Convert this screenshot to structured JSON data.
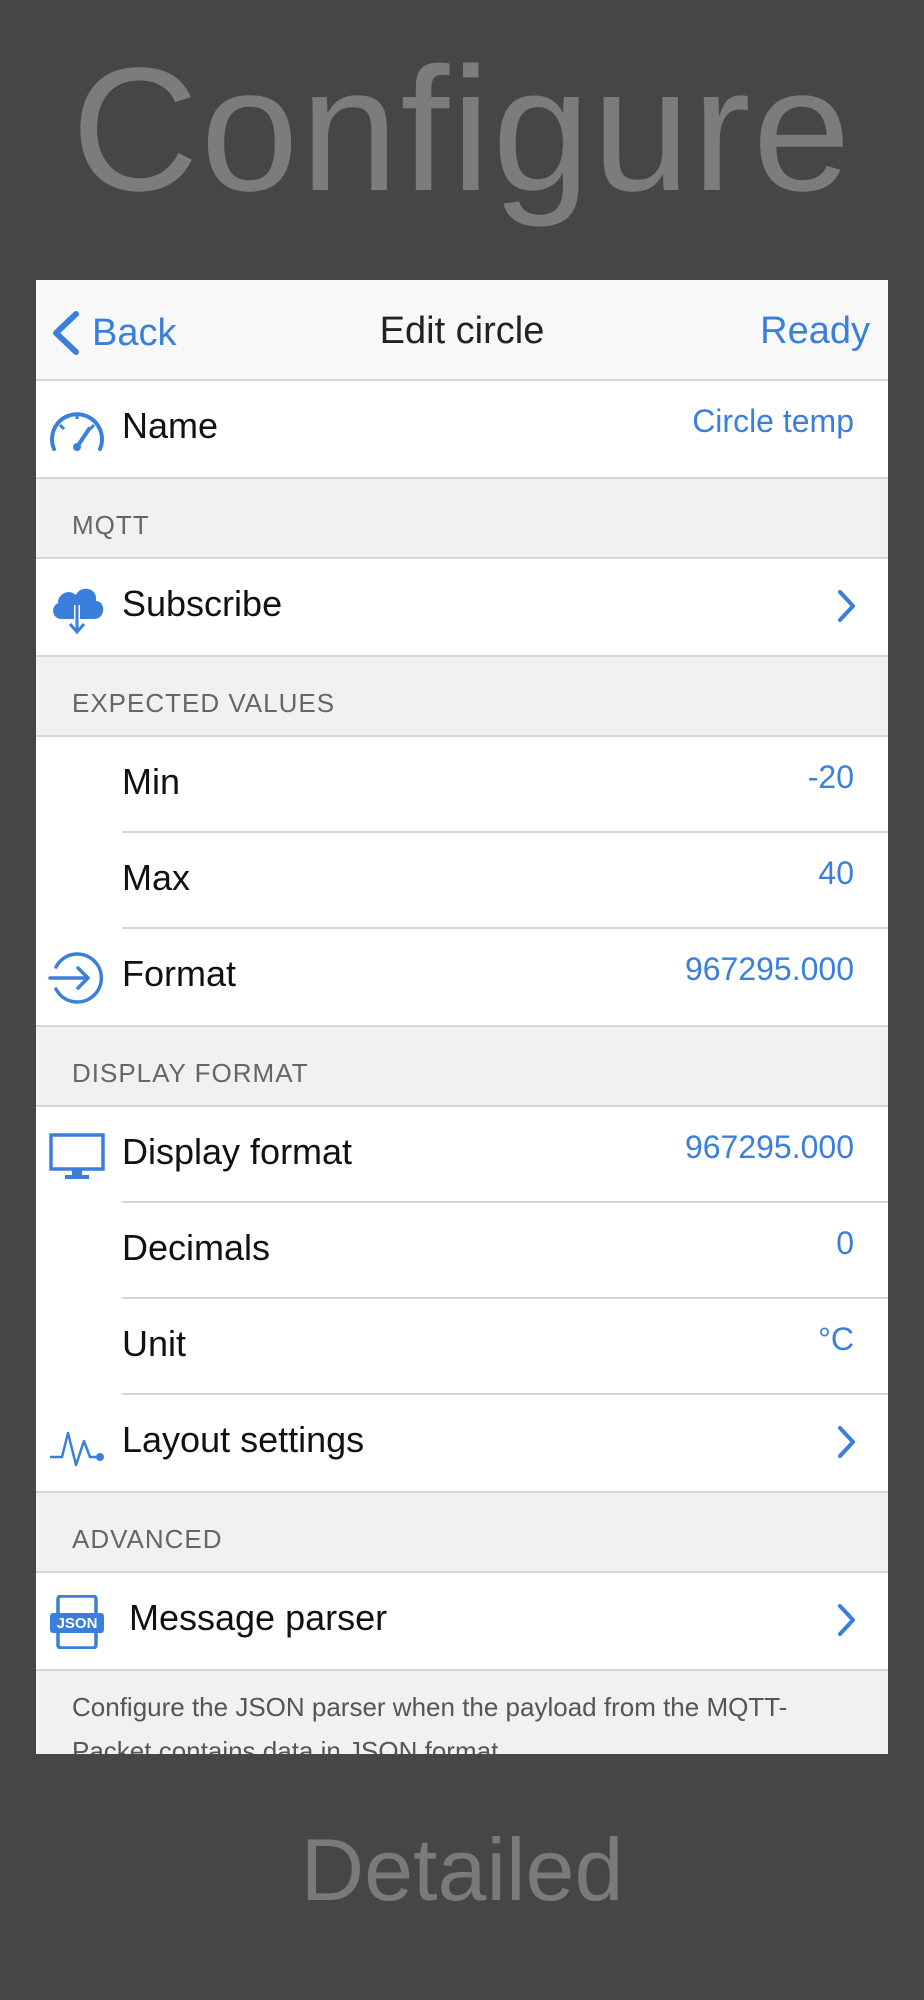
{
  "promo": {
    "top": "Configure",
    "bottom": "Detailed"
  },
  "navbar": {
    "back_label": "Back",
    "title": "Edit circle",
    "ready_label": "Ready"
  },
  "name_row": {
    "label": "Name",
    "value": "Circle temp",
    "icon": "gauge-icon"
  },
  "sections": {
    "mqtt": "MQTT",
    "expected": "EXPECTED VALUES",
    "display": "DISPLAY FORMAT",
    "advanced": "ADVANCED"
  },
  "mqtt": {
    "subscribe_label": "Subscribe",
    "icon": "cloud-download-icon"
  },
  "expected": {
    "min_label": "Min",
    "min_value": "-20",
    "max_label": "Max",
    "max_value": "40",
    "format_label": "Format",
    "format_value": "967295.000",
    "format_icon": "arrow-in-circle-icon"
  },
  "display": {
    "display_format_label": "Display format",
    "display_format_value": "967295.000",
    "display_icon": "monitor-icon",
    "decimals_label": "Decimals",
    "decimals_value": "0",
    "unit_label": "Unit",
    "unit_value": "°C",
    "layout_label": "Layout settings",
    "layout_icon": "pulse-wave-icon"
  },
  "advanced": {
    "parser_label": "Message parser",
    "parser_icon": "json-file-icon",
    "json_badge": "JSON",
    "note": "Configure the JSON parser when the payload from the MQTT-Packet contains data in JSON format."
  },
  "colors": {
    "accent": "#3b7fdd",
    "background": "#464646",
    "grouped_bg": "#f1f1f1"
  }
}
